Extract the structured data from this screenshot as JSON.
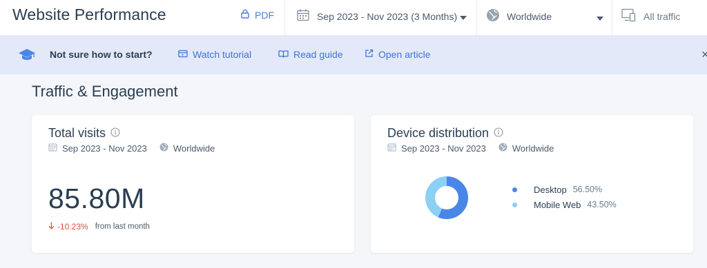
{
  "header": {
    "title": "Website Performance",
    "pdf_label": "PDF",
    "date_range": "Sep 2023 - Nov 2023 (3 Months)",
    "country": "Worldwide",
    "traffic_type": "All traffic"
  },
  "banner": {
    "prompt": "Not sure how to start?",
    "links": [
      "Watch tutorial",
      "Read guide",
      "Open article"
    ]
  },
  "section": {
    "title": "Traffic & Engagement"
  },
  "total_visits": {
    "title": "Total visits",
    "date": "Sep 2023 - Nov 2023",
    "country": "Worldwide",
    "value": "85.80M",
    "change": "-10.23%",
    "change_label": "from last month"
  },
  "device": {
    "title": "Device distribution",
    "date": "Sep 2023 - Nov 2023",
    "country": "Worldwide",
    "items": [
      {
        "name": "Desktop",
        "pct": "56.50%",
        "color": "#4a86e8"
      },
      {
        "name": "Mobile Web",
        "pct": "43.50%",
        "color": "#8dd0f5"
      }
    ]
  },
  "chart_data": {
    "type": "pie",
    "categories": [
      "Desktop",
      "Mobile Web"
    ],
    "values": [
      56.5,
      43.5
    ],
    "colors": [
      "#4a86e8",
      "#8dd0f5"
    ]
  },
  "colors": {
    "accent": "#3f72d6",
    "negative": "#e5483d",
    "banner_bg": "#e3e9f8"
  }
}
